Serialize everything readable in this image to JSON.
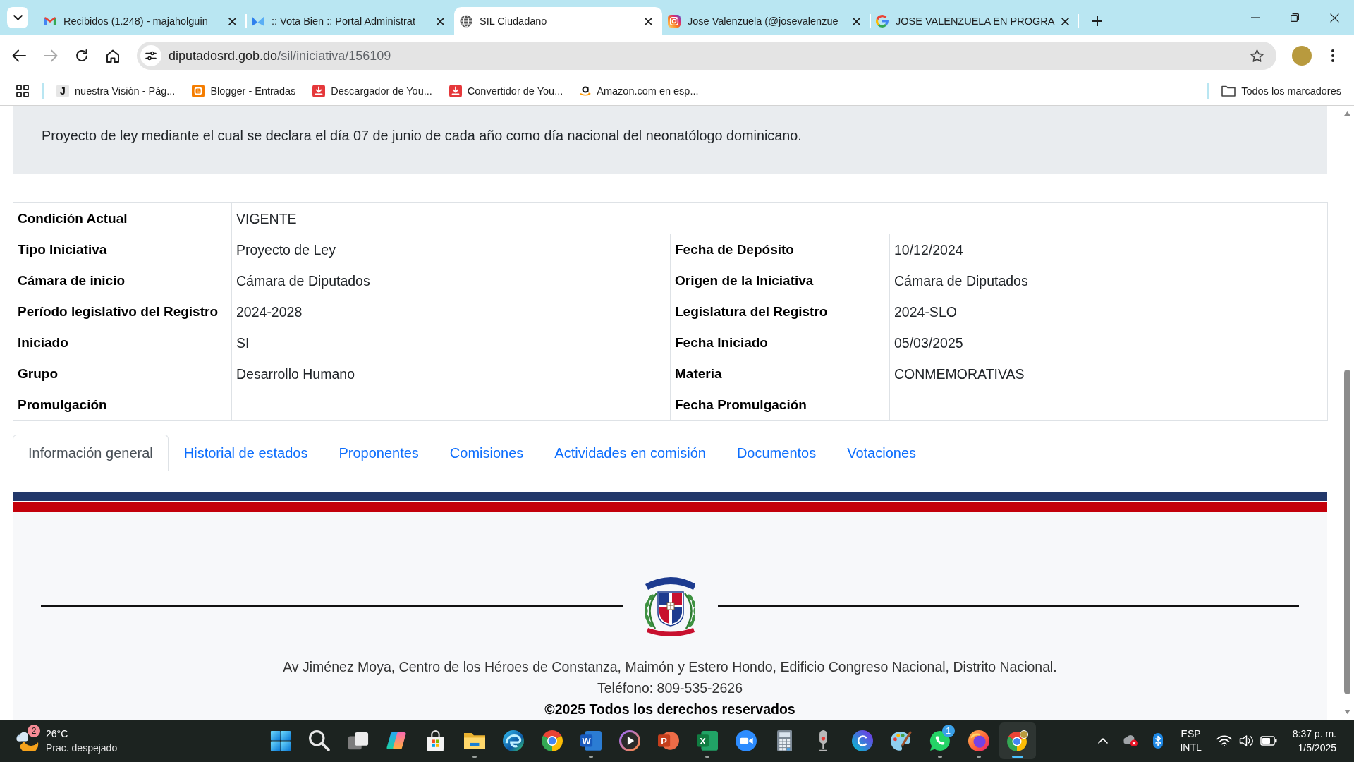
{
  "browser": {
    "tabs": [
      {
        "kind": "mail",
        "title": "Recibidos (1.248) - majaholguin",
        "selected": false
      },
      {
        "kind": "portal",
        "title": ":: Vota Bien :: Portal Administrat",
        "selected": false
      },
      {
        "kind": "globe",
        "title": "SIL Ciudadano",
        "selected": true
      },
      {
        "kind": "camera",
        "title": "Jose Valenzuela (@josevalenzue",
        "selected": false
      },
      {
        "kind": "search",
        "title": "JOSE VALENZUELA EN PROGRA",
        "selected": false
      }
    ],
    "toolbar": {
      "forward_disabled": true,
      "address": {
        "host": "diputadosrd.gob.do",
        "path": "/sil/iniciativa/156109"
      }
    },
    "bookmarks": [
      {
        "kind": "letter",
        "letter": "J",
        "label": "nuestra Visión - Pág..."
      },
      {
        "kind": "blog",
        "label": "Blogger - Entradas"
      },
      {
        "kind": "download",
        "label": "Descargador de You..."
      },
      {
        "kind": "download",
        "label": "Convertidor de You..."
      },
      {
        "kind": "shop",
        "label": "Amazon.com en esp..."
      }
    ],
    "all_bookmarks": "Todos los marcadores"
  },
  "page": {
    "description": "Proyecto de ley mediante el cual se declara el día 07 de junio de cada año como día nacional del neonatólogo dominicano.",
    "details": [
      [
        {
          "label": "Condición Actual",
          "value": "VIGENTE"
        }
      ],
      [
        {
          "label": "Tipo Iniciativa",
          "value": "Proyecto de Ley"
        },
        {
          "label": "Fecha de Depósito",
          "value": "10/12/2024"
        }
      ],
      [
        {
          "label": "Cámara de inicio",
          "value": "Cámara de Diputados"
        },
        {
          "label": "Origen de la Iniciativa",
          "value": "Cámara de Diputados"
        }
      ],
      [
        {
          "label": "Período legislativo del Registro",
          "value": "2024-2028"
        },
        {
          "label": "Legislatura del Registro",
          "value": "2024-SLO"
        }
      ],
      [
        {
          "label": "Iniciado",
          "value": "SI"
        },
        {
          "label": "Fecha Iniciado",
          "value": "05/03/2025"
        }
      ],
      [
        {
          "label": "Grupo",
          "value": "Desarrollo Humano"
        },
        {
          "label": "Materia",
          "value": "CONMEMORATIVAS"
        }
      ],
      [
        {
          "label": "Promulgación"
        },
        {
          "label": "Fecha Promulgación"
        }
      ]
    ],
    "tabs": [
      {
        "label": "Información general",
        "selected": true
      },
      {
        "label": "Historial de estados",
        "selected": false
      },
      {
        "label": "Proponentes",
        "selected": false
      },
      {
        "label": "Comisiones",
        "selected": false
      },
      {
        "label": "Actividades en comisión",
        "selected": false
      },
      {
        "label": "Documentos",
        "selected": false
      },
      {
        "label": "Votaciones",
        "selected": false
      }
    ],
    "footer": {
      "address": "Av Jiménez Moya, Centro de los Héroes de Constanza, Maimón y Estero Hondo, Edificio Congreso Nacional, Distrito Nacional.",
      "phone": "Teléfono: 809-535-2626",
      "copyright": "©2025 Todos los derechos reservados"
    }
  },
  "taskbar": {
    "weather": {
      "alerts": "2",
      "temperature": "26°C",
      "condition": "Prac. despejado"
    },
    "apps": [
      {
        "kind": "start",
        "running": false,
        "selected": false
      },
      {
        "kind": "search",
        "running": false,
        "selected": false
      },
      {
        "kind": "taskview",
        "running": false,
        "selected": false
      },
      {
        "kind": "copilot",
        "running": false,
        "selected": false
      },
      {
        "kind": "store",
        "running": false,
        "selected": false
      },
      {
        "kind": "files",
        "running": true,
        "selected": false
      },
      {
        "kind": "edge",
        "running": false,
        "selected": false
      },
      {
        "kind": "chrome",
        "running": false,
        "selected": false
      },
      {
        "kind": "word",
        "letter": "W",
        "running": true,
        "selected": false
      },
      {
        "kind": "media",
        "running": false,
        "selected": false
      },
      {
        "kind": "slides",
        "letter": "P",
        "running": false,
        "selected": false
      },
      {
        "kind": "sheets",
        "letter": "X",
        "running": true,
        "selected": false
      },
      {
        "kind": "meeting",
        "running": false,
        "selected": false
      },
      {
        "kind": "calculator",
        "running": false,
        "selected": false
      },
      {
        "kind": "recorder",
        "running": false,
        "selected": false
      },
      {
        "kind": "design",
        "running": false,
        "selected": false
      },
      {
        "kind": "paint",
        "running": false,
        "selected": false
      },
      {
        "kind": "chat",
        "badge": "1",
        "running": true,
        "selected": false
      },
      {
        "kind": "firefox",
        "running": true,
        "selected": false
      },
      {
        "kind": "chrome_profile",
        "running": true,
        "selected": true
      }
    ],
    "tray": {
      "language": "ESP",
      "layout": "INTL",
      "time": "8:37 p. m.",
      "date": "1/5/2025"
    }
  }
}
